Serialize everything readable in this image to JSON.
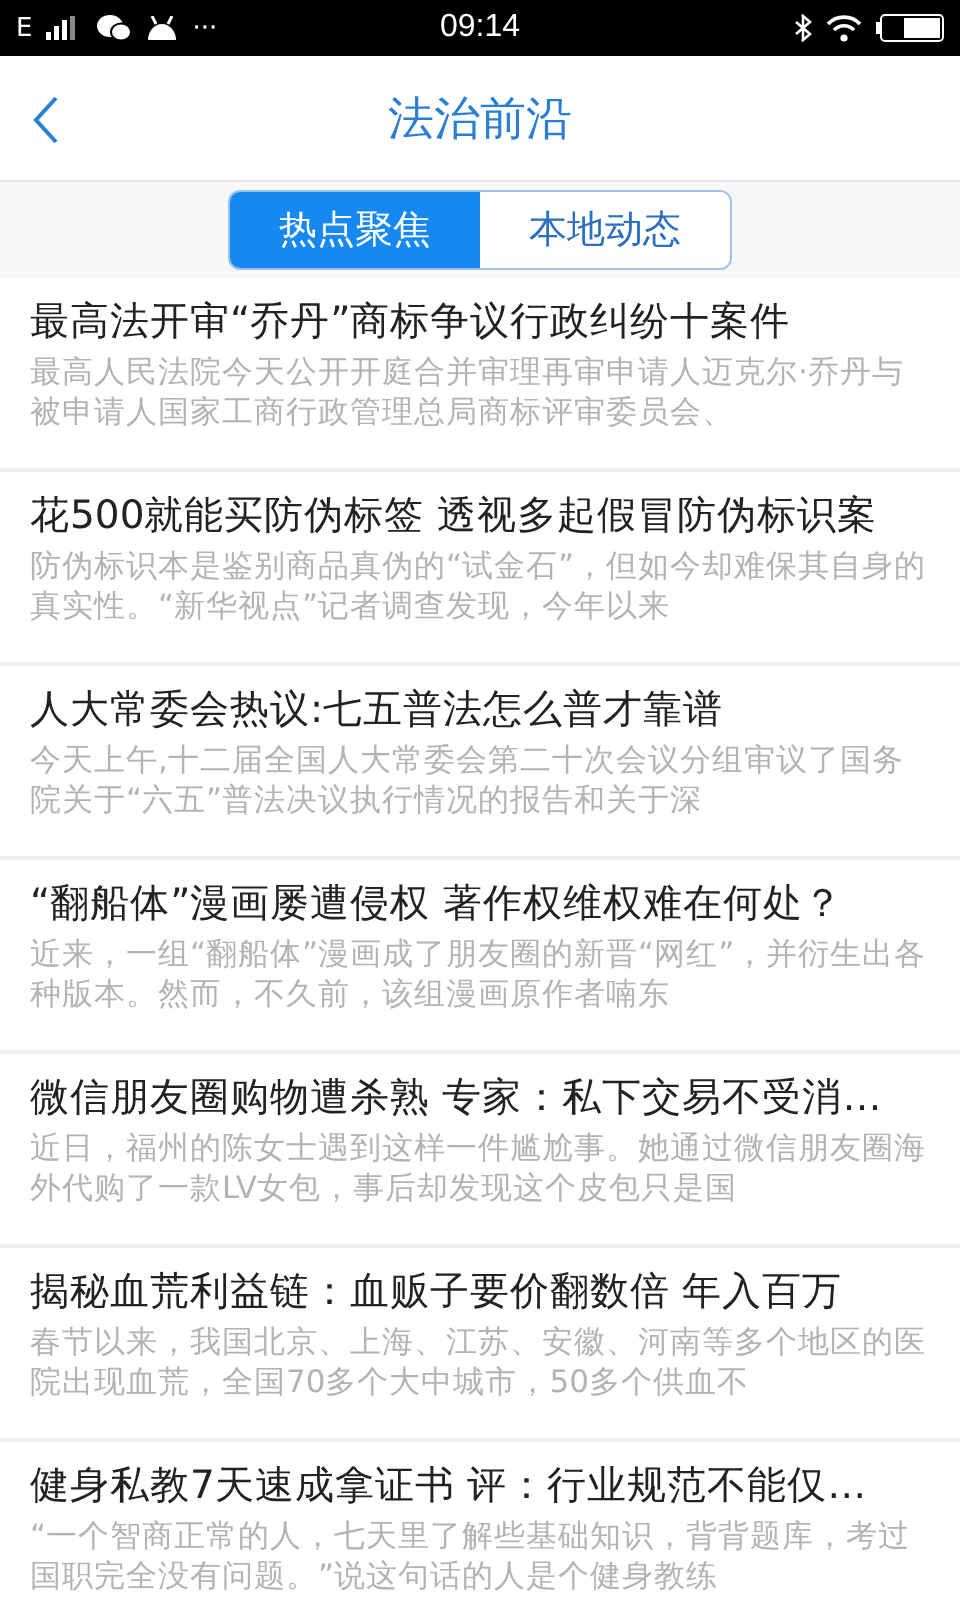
{
  "status_bar": {
    "network": "E",
    "time": "09:14",
    "notification_more": "···"
  },
  "header": {
    "title": "法治前沿"
  },
  "tabs": [
    {
      "label": "热点聚焦",
      "selected": true
    },
    {
      "label": "本地动态",
      "selected": false
    }
  ],
  "articles": [
    {
      "title": "最高法开审“乔丹”商标争议行政纠纷十案件",
      "summary": "最高人民法院今天公开开庭合并审理再审申请人迈克尔·乔丹与被申请人国家工商行政管理总局商标评审委员会、"
    },
    {
      "title": "花500就能买防伪标签 透视多起假冒防伪标识案",
      "summary": "防伪标识本是鉴别商品真伪的“试金石”，但如今却难保其自身的真实性。“新华视点”记者调查发现，今年以来"
    },
    {
      "title": "人大常委会热议:七五普法怎么普才靠谱",
      "summary": "今天上午,十二届全国人大常委会第二十次会议分组审议了国务院关于“六五”普法决议执行情况的报告和关于深"
    },
    {
      "title": "“翻船体”漫画屡遭侵权 著作权维权难在何处？",
      "summary": "近来，一组“翻船体”漫画成了朋友圈的新晋“网红”，并衍生出各种版本。然而，不久前，该组漫画原作者喃东"
    },
    {
      "title": "微信朋友圈购物遭杀熟 专家：私下交易不受消…",
      "summary": "近日，福州的陈女士遇到这样一件尴尬事。她通过微信朋友圈海外代购了一款LV女包，事后却发现这个皮包只是国"
    },
    {
      "title": "揭秘血荒利益链：血贩子要价翻数倍 年入百万",
      "summary": "春节以来，我国北京、上海、江苏、安徽、河南等多个地区的医院出现血荒，全国70多个大中城市，50多个供血不"
    },
    {
      "title": "健身私教7天速成拿证书 评：行业规范不能仅…",
      "summary": "“一个智商正常的人，七天里了解些基础知识，背背题库，考过国职完全没有问题。”说这句话的人是个健身教练"
    }
  ]
}
